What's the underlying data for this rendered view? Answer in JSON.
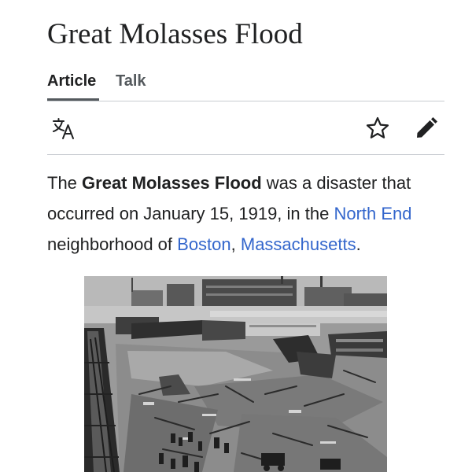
{
  "article": {
    "title": "Great Molasses Flood"
  },
  "tabs": [
    {
      "label": "Article",
      "selected": true
    },
    {
      "label": "Talk",
      "selected": false
    }
  ],
  "toolbar": {
    "language_icon": "translate-icon",
    "watch_icon": "star-icon",
    "edit_icon": "pencil-icon"
  },
  "intro": {
    "lead": "The ",
    "bold_term": "Great Molasses Flood",
    "text_1": " was a disaster that occurred on January 15, 1919, in the ",
    "link_1": "North End",
    "text_2": " neighborhood of ",
    "link_2": "Boston",
    "text_3": ", ",
    "link_3": "Massachusetts",
    "text_4": "."
  },
  "colors": {
    "text": "#202122",
    "link": "#3366cc",
    "muted": "#54595d",
    "divider": "#c8ccd1"
  },
  "image": {
    "description_kind": "black-and-white photograph"
  }
}
